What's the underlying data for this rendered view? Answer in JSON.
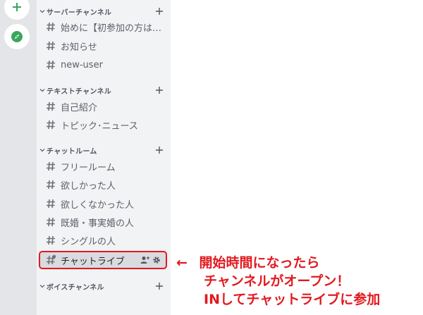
{
  "categories": [
    {
      "label": "サーバーチャンネル",
      "channels": [
        "始めに【初参加の方は…",
        "お知らせ",
        "new-user"
      ]
    },
    {
      "label": "テキストチャンネル",
      "channels": [
        "自己紹介",
        "トピック･ニュース"
      ]
    },
    {
      "label": "チャットルーム",
      "channels": [
        "フリールーム",
        "欲しかった人",
        "欲しくなかった人",
        "既婚・事実婚の人",
        "シングルの人",
        "チャットライブ"
      ]
    },
    {
      "label": "ボイスチャンネル",
      "channels": []
    }
  ],
  "annotation": {
    "arrow": "←",
    "line1": "開始時間になったら",
    "line2": "チャンネルがオープン！",
    "line3": "INしてチャットライブに参加"
  },
  "colors": {
    "accent_red": "#e3191f",
    "rail_green": "#3ba55d"
  },
  "icons": {
    "add_server": "plus-icon",
    "explore": "compass-icon",
    "channel": "hash-icon",
    "invite": "add-user-icon",
    "settings": "gear-icon"
  }
}
